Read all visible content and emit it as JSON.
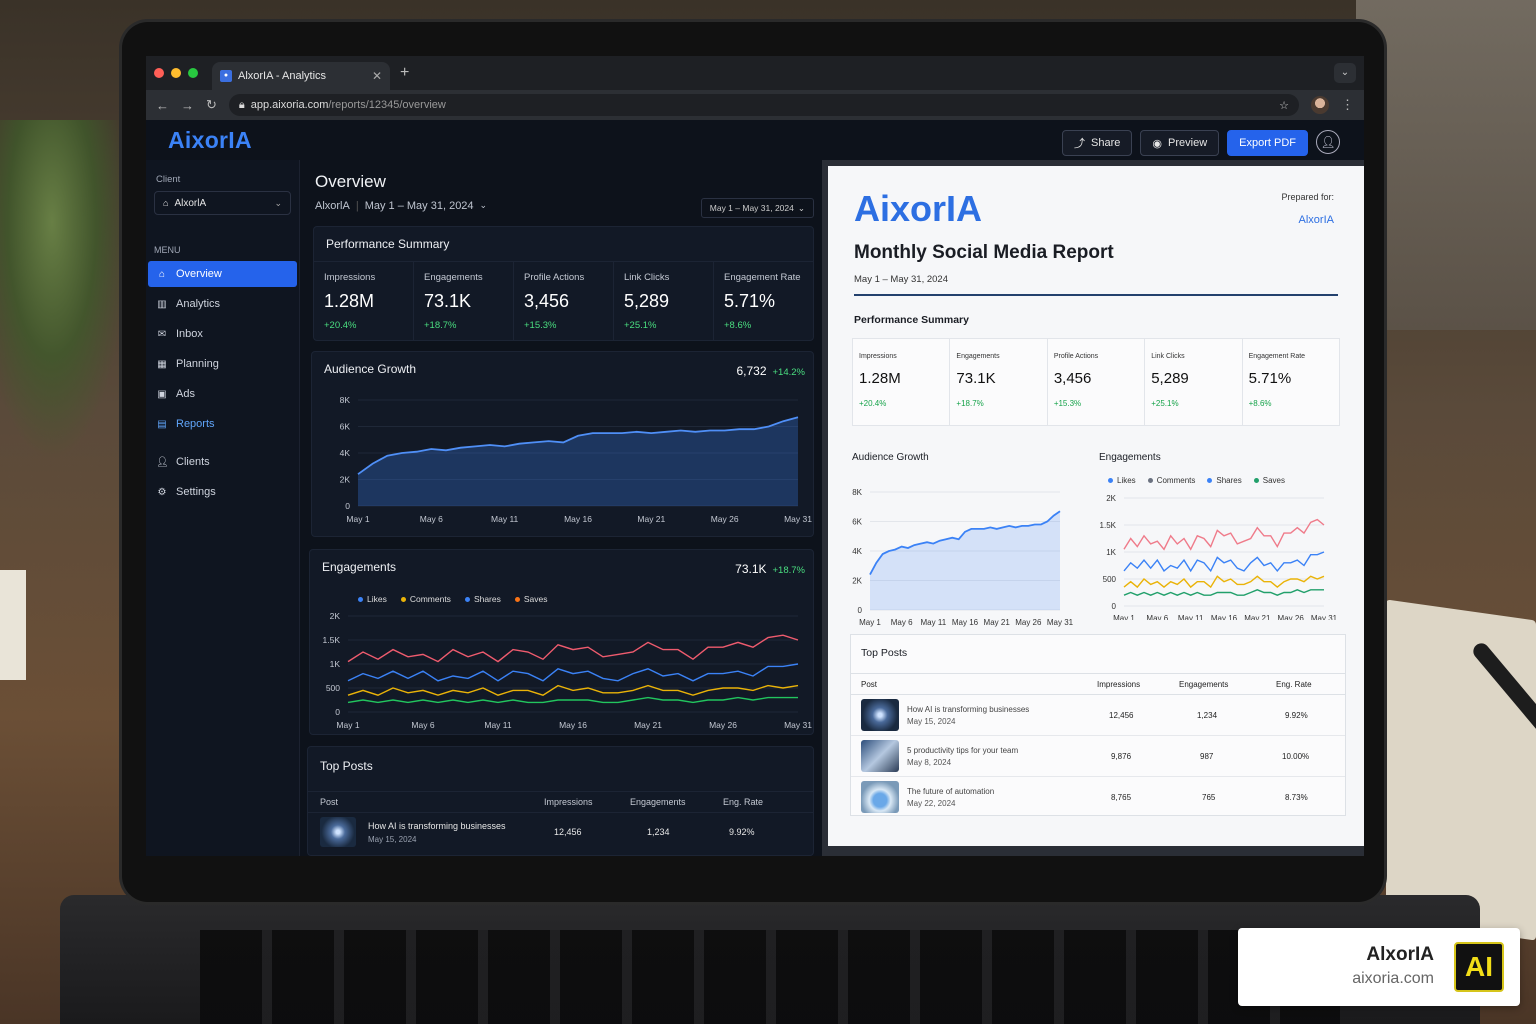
{
  "browser": {
    "tab_title": "AlxorIA - Analytics",
    "url_domain": "app.aixoria.com",
    "url_path": "/reports/12345/overview"
  },
  "header": {
    "brand": "AixorIA",
    "share": "Share",
    "preview": "Preview",
    "export": "Export PDF"
  },
  "sidebar": {
    "client_label": "Client",
    "client_value": "AlxorlA",
    "menu_label": "MENU",
    "items": [
      {
        "label": "Overview",
        "icon": "home-icon"
      },
      {
        "label": "Analytics",
        "icon": "bar-chart-icon"
      },
      {
        "label": "Inbox",
        "icon": "inbox-icon"
      },
      {
        "label": "Planning",
        "icon": "calendar-icon"
      },
      {
        "label": "Ads",
        "icon": "ads-icon"
      },
      {
        "label": "Reports",
        "icon": "report-icon"
      },
      {
        "label": "Clients",
        "icon": "user-icon"
      },
      {
        "label": "Settings",
        "icon": "gear-icon"
      }
    ]
  },
  "overview": {
    "title": "Overview",
    "client": "AlxorlA",
    "range": "May 1 – May 31, 2024",
    "date_button": "May 1 – May 31, 2024"
  },
  "performance": {
    "title": "Performance Summary",
    "kpis": [
      {
        "label": "Impressions",
        "value": "1.28M",
        "change": "+20.4%"
      },
      {
        "label": "Engagements",
        "value": "73.1K",
        "change": "+18.7%"
      },
      {
        "label": "Profile Actions",
        "value": "3,456",
        "change": "+15.3%"
      },
      {
        "label": "Link Clicks",
        "value": "5,289",
        "change": "+25.1%"
      },
      {
        "label": "Engagement Rate",
        "value": "5.71%",
        "change": "+8.6%"
      }
    ]
  },
  "audience": {
    "title": "Audience Growth",
    "value": "6,732",
    "change": "+14.2%"
  },
  "engagements": {
    "title": "Engagements",
    "value": "73.1K",
    "change": "+18.7%",
    "legend": [
      "Likes",
      "Comments",
      "Shares",
      "Saves"
    ]
  },
  "top_posts": {
    "title": "Top Posts",
    "headers": [
      "Post",
      "Impressions",
      "Engagements",
      "Eng. Rate"
    ],
    "rows": [
      {
        "title": "How AI is transforming businesses",
        "date": "May 15, 2024",
        "impressions": "12,456",
        "engagements": "1,234",
        "rate": "9.92%"
      },
      {
        "title": "5 productivity tips for your team",
        "date": "May 8, 2024",
        "impressions": "9,876",
        "engagements": "987",
        "rate": "10.00%"
      },
      {
        "title": "The future of automation",
        "date": "May 22, 2024",
        "impressions": "8,765",
        "engagements": "765",
        "rate": "8.73%"
      }
    ]
  },
  "report": {
    "brand": "AixorIA",
    "prepared_for": "Prepared for:",
    "client": "AlxorIA",
    "title": "Monthly Social Media Report",
    "date": "May 1 – May 31, 2024",
    "perf_title": "Performance Summary",
    "audience_title": "Audience Growth",
    "engagements_title": "Engagements",
    "top_posts_title": "Top Posts"
  },
  "watermark": {
    "name": "AlxorIA",
    "url": "aixoria.com",
    "logo": "AI"
  },
  "colors": {
    "accent": "#2563eb",
    "likes": "#ef5b6e",
    "comments": "#3b82f6",
    "shares": "#eab308",
    "saves": "#22c55e",
    "positive": "#4ade80"
  },
  "chart_data": [
    {
      "type": "area",
      "title": "Audience Growth",
      "x": [
        "May 1",
        "May 6",
        "May 11",
        "May 16",
        "May 21",
        "May 26",
        "May 31"
      ],
      "ylim": [
        0,
        8000
      ],
      "yticks": [
        "0",
        "2K",
        "4K",
        "6K",
        "8K"
      ],
      "values": [
        2400,
        3200,
        3800,
        4000,
        4100,
        4300,
        4200,
        4400,
        4500,
        4600,
        4500,
        4700,
        4800,
        4900,
        4800,
        5300,
        5500,
        5500,
        5500,
        5600,
        5500,
        5600,
        5700,
        5600,
        5700,
        5700,
        5800,
        5800,
        6000,
        6400,
        6700
      ]
    },
    {
      "type": "line",
      "title": "Engagements",
      "x": [
        "May 1",
        "May 6",
        "May 11",
        "May 16",
        "May 21",
        "May 26",
        "May 31"
      ],
      "ylim": [
        0,
        2000
      ],
      "yticks": [
        "0",
        "500",
        "1K",
        "1.5K",
        "2K"
      ],
      "series": [
        {
          "name": "Likes",
          "values": [
            1050,
            1250,
            1100,
            1300,
            1150,
            1200,
            1050,
            1300,
            1150,
            1250,
            1050,
            1300,
            1250,
            1100,
            1400,
            1300,
            1350,
            1150,
            1200,
            1250,
            1450,
            1300,
            1300,
            1100,
            1350,
            1350,
            1450,
            1350,
            1550,
            1600,
            1500
          ]
        },
        {
          "name": "Comments",
          "values": [
            650,
            800,
            700,
            850,
            700,
            850,
            650,
            750,
            700,
            850,
            650,
            850,
            800,
            650,
            900,
            800,
            850,
            700,
            650,
            800,
            900,
            750,
            800,
            650,
            800,
            800,
            850,
            750,
            950,
            950,
            1000
          ]
        },
        {
          "name": "Shares",
          "values": [
            350,
            450,
            350,
            500,
            400,
            450,
            350,
            450,
            400,
            500,
            350,
            450,
            450,
            350,
            550,
            450,
            500,
            400,
            400,
            450,
            550,
            450,
            450,
            350,
            450,
            500,
            500,
            450,
            550,
            500,
            550
          ]
        },
        {
          "name": "Saves",
          "values": [
            200,
            250,
            200,
            250,
            200,
            250,
            200,
            250,
            200,
            250,
            200,
            250,
            200,
            200,
            250,
            250,
            250,
            200,
            200,
            250,
            300,
            250,
            250,
            200,
            250,
            250,
            300,
            250,
            300,
            300,
            300
          ]
        }
      ]
    }
  ]
}
